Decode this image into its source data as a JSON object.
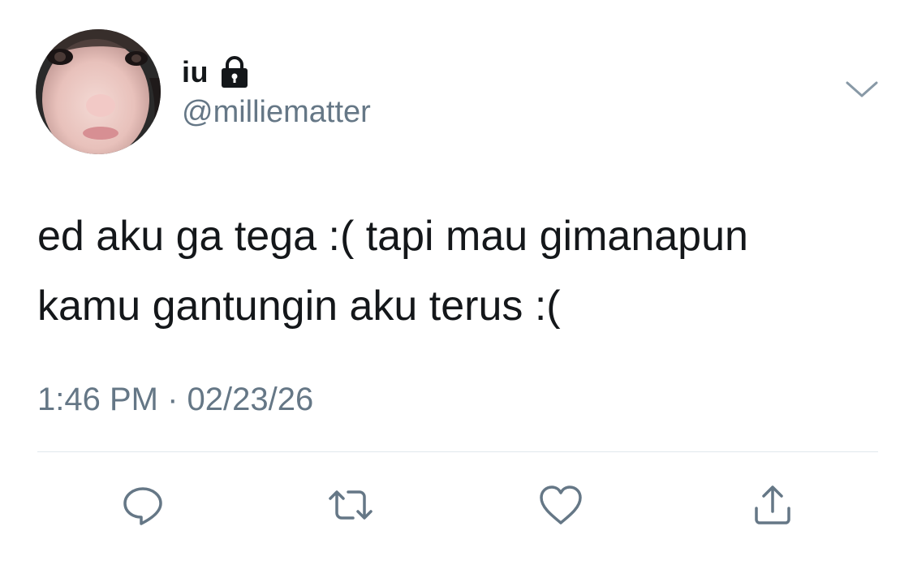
{
  "header": {
    "display_name": "iu",
    "handle": "@milliematter",
    "protected_icon": "lock-icon",
    "menu_icon": "chevron-down-icon"
  },
  "tweet": {
    "text_lines": [
      "ed aku ga tega :( tapi mau gimanapun",
      "kamu gantungin aku terus :("
    ],
    "timestamp": "1:46 PM · 02/23/26"
  },
  "actions": [
    {
      "icon": "reply-icon"
    },
    {
      "icon": "retweet-icon"
    },
    {
      "icon": "like-icon"
    },
    {
      "icon": "share-icon"
    }
  ],
  "colors": {
    "text_primary": "#14171a",
    "text_secondary": "#657786",
    "icon": "#657786",
    "divider": "#e1e8ed"
  }
}
